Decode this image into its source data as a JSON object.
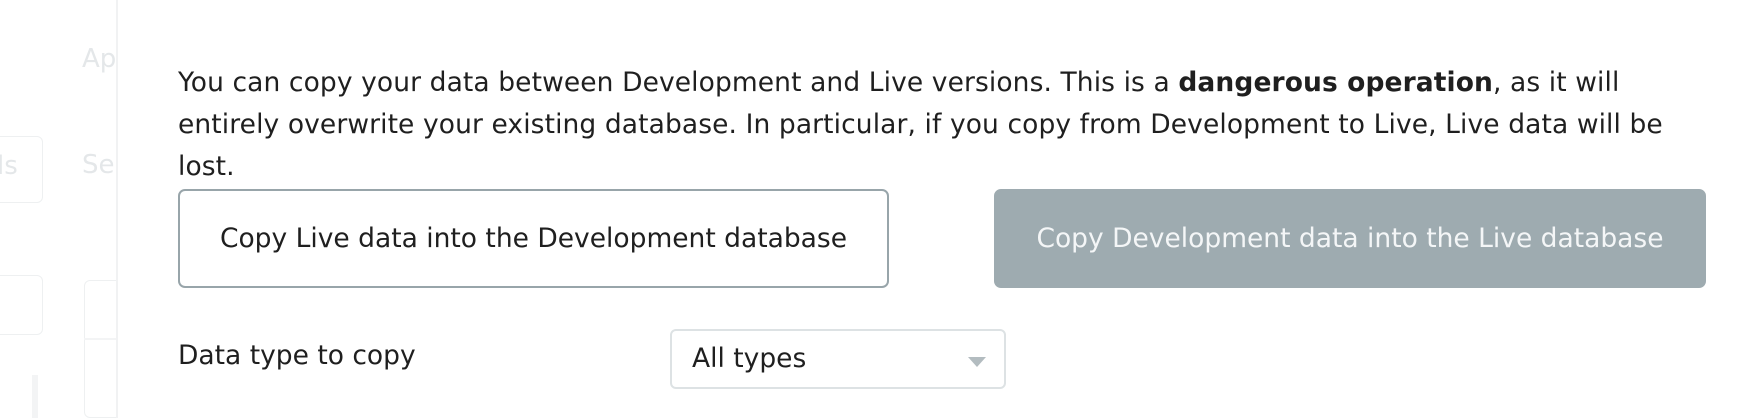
{
  "background": {
    "fragment_1": "Ap",
    "fragment_2": "ls",
    "fragment_3": "Se"
  },
  "panel": {
    "description_part1": "You can copy your data between Development and Live versions. This is a ",
    "description_bold": "dangerous operation",
    "description_part2": ", as it will entirely overwrite your existing database. In particular, if you copy from Development to Live, Live data will be lost.",
    "copy_live_to_dev_label": "Copy Live data into the Development database",
    "copy_dev_to_live_label": "Copy Development data into the Live database",
    "data_type_label": "Data type to copy",
    "data_type_select": {
      "selected": "All types"
    }
  },
  "colors": {
    "accent_disabled_button": "#9eabb0",
    "outline_button_border": "#98a5aa",
    "text": "#1f1f1f"
  },
  "icons": {
    "select_caret": "chevron-down-icon"
  }
}
